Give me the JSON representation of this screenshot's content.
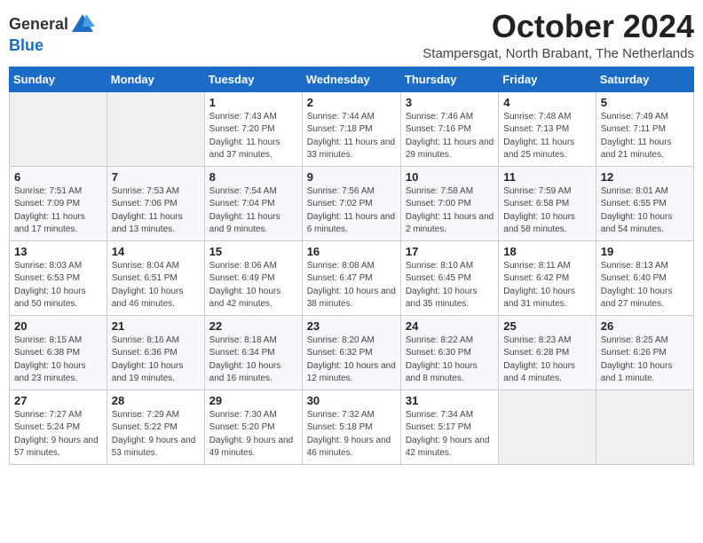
{
  "logo": {
    "general": "General",
    "blue": "Blue"
  },
  "title": "October 2024",
  "subtitle": "Stampersgat, North Brabant, The Netherlands",
  "days_of_week": [
    "Sunday",
    "Monday",
    "Tuesday",
    "Wednesday",
    "Thursday",
    "Friday",
    "Saturday"
  ],
  "weeks": [
    [
      {
        "day": "",
        "info": ""
      },
      {
        "day": "",
        "info": ""
      },
      {
        "day": "1",
        "info": "Sunrise: 7:43 AM\nSunset: 7:20 PM\nDaylight: 11 hours and 37 minutes."
      },
      {
        "day": "2",
        "info": "Sunrise: 7:44 AM\nSunset: 7:18 PM\nDaylight: 11 hours and 33 minutes."
      },
      {
        "day": "3",
        "info": "Sunrise: 7:46 AM\nSunset: 7:16 PM\nDaylight: 11 hours and 29 minutes."
      },
      {
        "day": "4",
        "info": "Sunrise: 7:48 AM\nSunset: 7:13 PM\nDaylight: 11 hours and 25 minutes."
      },
      {
        "day": "5",
        "info": "Sunrise: 7:49 AM\nSunset: 7:11 PM\nDaylight: 11 hours and 21 minutes."
      }
    ],
    [
      {
        "day": "6",
        "info": "Sunrise: 7:51 AM\nSunset: 7:09 PM\nDaylight: 11 hours and 17 minutes."
      },
      {
        "day": "7",
        "info": "Sunrise: 7:53 AM\nSunset: 7:06 PM\nDaylight: 11 hours and 13 minutes."
      },
      {
        "day": "8",
        "info": "Sunrise: 7:54 AM\nSunset: 7:04 PM\nDaylight: 11 hours and 9 minutes."
      },
      {
        "day": "9",
        "info": "Sunrise: 7:56 AM\nSunset: 7:02 PM\nDaylight: 11 hours and 6 minutes."
      },
      {
        "day": "10",
        "info": "Sunrise: 7:58 AM\nSunset: 7:00 PM\nDaylight: 11 hours and 2 minutes."
      },
      {
        "day": "11",
        "info": "Sunrise: 7:59 AM\nSunset: 6:58 PM\nDaylight: 10 hours and 58 minutes."
      },
      {
        "day": "12",
        "info": "Sunrise: 8:01 AM\nSunset: 6:55 PM\nDaylight: 10 hours and 54 minutes."
      }
    ],
    [
      {
        "day": "13",
        "info": "Sunrise: 8:03 AM\nSunset: 6:53 PM\nDaylight: 10 hours and 50 minutes."
      },
      {
        "day": "14",
        "info": "Sunrise: 8:04 AM\nSunset: 6:51 PM\nDaylight: 10 hours and 46 minutes."
      },
      {
        "day": "15",
        "info": "Sunrise: 8:06 AM\nSunset: 6:49 PM\nDaylight: 10 hours and 42 minutes."
      },
      {
        "day": "16",
        "info": "Sunrise: 8:08 AM\nSunset: 6:47 PM\nDaylight: 10 hours and 38 minutes."
      },
      {
        "day": "17",
        "info": "Sunrise: 8:10 AM\nSunset: 6:45 PM\nDaylight: 10 hours and 35 minutes."
      },
      {
        "day": "18",
        "info": "Sunrise: 8:11 AM\nSunset: 6:42 PM\nDaylight: 10 hours and 31 minutes."
      },
      {
        "day": "19",
        "info": "Sunrise: 8:13 AM\nSunset: 6:40 PM\nDaylight: 10 hours and 27 minutes."
      }
    ],
    [
      {
        "day": "20",
        "info": "Sunrise: 8:15 AM\nSunset: 6:38 PM\nDaylight: 10 hours and 23 minutes."
      },
      {
        "day": "21",
        "info": "Sunrise: 8:16 AM\nSunset: 6:36 PM\nDaylight: 10 hours and 19 minutes."
      },
      {
        "day": "22",
        "info": "Sunrise: 8:18 AM\nSunset: 6:34 PM\nDaylight: 10 hours and 16 minutes."
      },
      {
        "day": "23",
        "info": "Sunrise: 8:20 AM\nSunset: 6:32 PM\nDaylight: 10 hours and 12 minutes."
      },
      {
        "day": "24",
        "info": "Sunrise: 8:22 AM\nSunset: 6:30 PM\nDaylight: 10 hours and 8 minutes."
      },
      {
        "day": "25",
        "info": "Sunrise: 8:23 AM\nSunset: 6:28 PM\nDaylight: 10 hours and 4 minutes."
      },
      {
        "day": "26",
        "info": "Sunrise: 8:25 AM\nSunset: 6:26 PM\nDaylight: 10 hours and 1 minute."
      }
    ],
    [
      {
        "day": "27",
        "info": "Sunrise: 7:27 AM\nSunset: 5:24 PM\nDaylight: 9 hours and 57 minutes."
      },
      {
        "day": "28",
        "info": "Sunrise: 7:29 AM\nSunset: 5:22 PM\nDaylight: 9 hours and 53 minutes."
      },
      {
        "day": "29",
        "info": "Sunrise: 7:30 AM\nSunset: 5:20 PM\nDaylight: 9 hours and 49 minutes."
      },
      {
        "day": "30",
        "info": "Sunrise: 7:32 AM\nSunset: 5:18 PM\nDaylight: 9 hours and 46 minutes."
      },
      {
        "day": "31",
        "info": "Sunrise: 7:34 AM\nSunset: 5:17 PM\nDaylight: 9 hours and 42 minutes."
      },
      {
        "day": "",
        "info": ""
      },
      {
        "day": "",
        "info": ""
      }
    ]
  ]
}
